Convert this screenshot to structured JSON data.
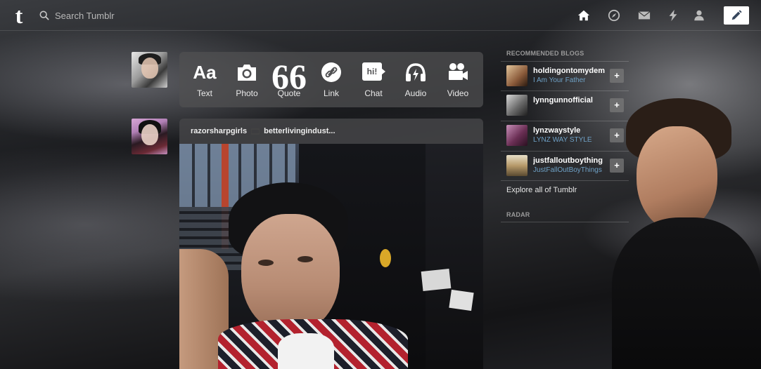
{
  "nav": {
    "logo": "t",
    "search_placeholder": "Search Tumblr",
    "icons": [
      "home-icon",
      "compass-icon",
      "mail-icon",
      "lightning-icon",
      "person-icon"
    ],
    "compose_icon": "pencil-icon"
  },
  "post_types": [
    {
      "label": "Text",
      "icon": "aa-icon"
    },
    {
      "label": "Photo",
      "icon": "camera-icon"
    },
    {
      "label": "Quote",
      "icon": "quote-icon"
    },
    {
      "label": "Link",
      "icon": "link-icon"
    },
    {
      "label": "Chat",
      "icon": "chat-icon"
    },
    {
      "label": "Audio",
      "icon": "headphones-icon"
    },
    {
      "label": "Video",
      "icon": "video-camera-icon"
    }
  ],
  "text_icon_glyph": "Aa",
  "quote_icon_glyph": "66",
  "chat_icon_glyph": "hi!",
  "post": {
    "author": "razorsharpgirls",
    "reblogged_from": "betterlivingindust..."
  },
  "sidebar": {
    "recommended_title": "RECOMMENDED BLOGS",
    "blogs": [
      {
        "name": "holdingontomydem",
        "title": "I Am Your Father"
      },
      {
        "name": "lynngunnofficial",
        "title": ""
      },
      {
        "name": "lynzwaystyle",
        "title": "LYNZ WAY STYLE"
      },
      {
        "name": "justfalloutboything",
        "title": "JustFallOutBoyThings"
      }
    ],
    "follow_label": "+",
    "explore_label": "Explore all of Tumblr",
    "radar_title": "RADAR"
  },
  "colors": {
    "post_bar_bg": "#505052",
    "blog_title_link": "#6fa1c6",
    "compose_bg": "#ffffff"
  }
}
